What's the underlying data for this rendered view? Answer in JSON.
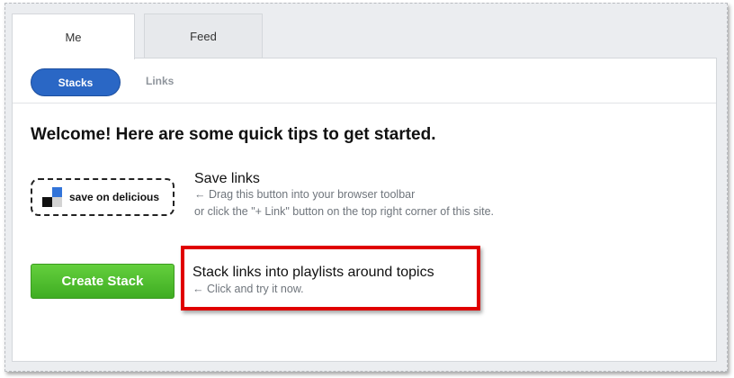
{
  "tabs": {
    "me": "Me",
    "feed": "Feed"
  },
  "subnav": {
    "stacks": "Stacks",
    "links": "Links"
  },
  "welcome": "Welcome! Here are some quick tips to get started.",
  "bookmarklet": {
    "label": "save on delicious",
    "icon": "delicious-logo-icon"
  },
  "tips": {
    "save": {
      "title": "Save links",
      "line1": "← Drag this button into your browser toolbar",
      "line2": "or click the \"+ Link\" button on the top right corner of this site."
    },
    "stack": {
      "title": "Stack links into playlists around topics",
      "line1": "← Click and try it now."
    }
  },
  "create_stack": "Create Stack",
  "colors": {
    "primary_blue": "#2a67c5",
    "create_green": "#4cbb2c",
    "highlight_red": "#e00000"
  }
}
